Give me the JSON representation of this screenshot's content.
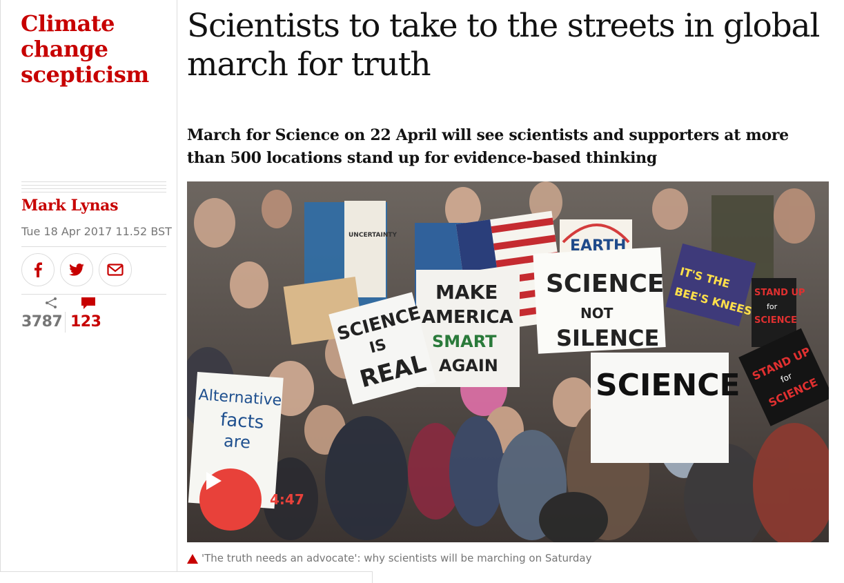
{
  "section": {
    "label_lines": [
      "Climate",
      "change",
      "scepticism"
    ]
  },
  "article": {
    "headline": "Scientists to take to the streets in global march for truth",
    "standfirst": "March for Science on 22 April will see scientists and supporters at more than 500 locations stand up for evidence-based thinking",
    "author": "Mark Lynas",
    "date": "Tue 18 Apr 2017 11.52 BST"
  },
  "share": {
    "buttons": [
      {
        "icon": "facebook-icon"
      },
      {
        "icon": "twitter-icon"
      },
      {
        "icon": "email-icon"
      }
    ],
    "share_count": "3787",
    "comment_count": "123"
  },
  "media": {
    "duration": "4:47",
    "caption": "'The truth needs an advocate': why scientists will be marching on Saturday",
    "signs": {
      "earth": "EARTH",
      "science_not_silence": [
        "SCIENCE",
        "NOT",
        "SILENCE"
      ],
      "make_america": [
        "MAKE",
        "AMERICA",
        "SMART",
        "AGAIN"
      ],
      "science_is_real": [
        "SCIENCE",
        "IS",
        "REAL"
      ],
      "alternative_facts": [
        "Alternative",
        "facts",
        "are"
      ],
      "stand_up_1": [
        "STAND UP",
        "for",
        "SCIENCE"
      ],
      "stand_up_2": [
        "STAND UP",
        "for",
        "SCIENCE"
      ],
      "science_bottom": "SCIENCE",
      "bees": [
        "IT'S THE",
        "BEE'S KNEES"
      ],
      "uncertainty": "UNCERTAINTY"
    }
  },
  "colors": {
    "accent": "#c70000",
    "play": "#e8413a",
    "muted": "#767676",
    "rule": "#dcdcdc"
  }
}
